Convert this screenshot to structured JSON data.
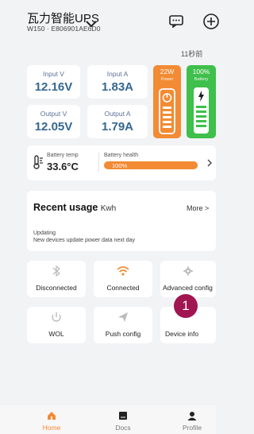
{
  "header": {
    "title": "瓦力智能UPS",
    "device_id": "W150 · E806901AE6D0",
    "updated": "11秒前"
  },
  "metrics": {
    "input_v_label": "Input V",
    "input_v_value": "12.16V",
    "input_a_label": "Input A",
    "input_a_value": "1.83A",
    "output_v_label": "Output V",
    "output_v_value": "12.05V",
    "output_a_label": "Output A",
    "output_a_value": "1.79A"
  },
  "power_card": {
    "value": "22W",
    "label": "Power"
  },
  "battery_card": {
    "value": "100%",
    "label": "Battery"
  },
  "battery_info": {
    "temp_label": "Battery temp",
    "temp_value": "33.6°C",
    "health_label": "Battery health",
    "health_value": "100%",
    "health_percent": 100
  },
  "recent_usage": {
    "title": "Recent usage",
    "unit": "Kwh",
    "more": "More >",
    "status": "Updating",
    "note": "New devices update power data next day"
  },
  "tiles": {
    "bluetooth": "Disconnected",
    "wifi": "Connected",
    "advanced": "Advanced config",
    "wol": "WOL",
    "push": "Push config",
    "device": "Device info"
  },
  "badge": "1",
  "nav": {
    "home": "Home",
    "docs": "Docs",
    "profile": "Profile"
  },
  "colors": {
    "accent": "#f28b34",
    "metric_text": "#35678f",
    "battery_green": "#3fbf4b",
    "badge": "#a11650"
  }
}
